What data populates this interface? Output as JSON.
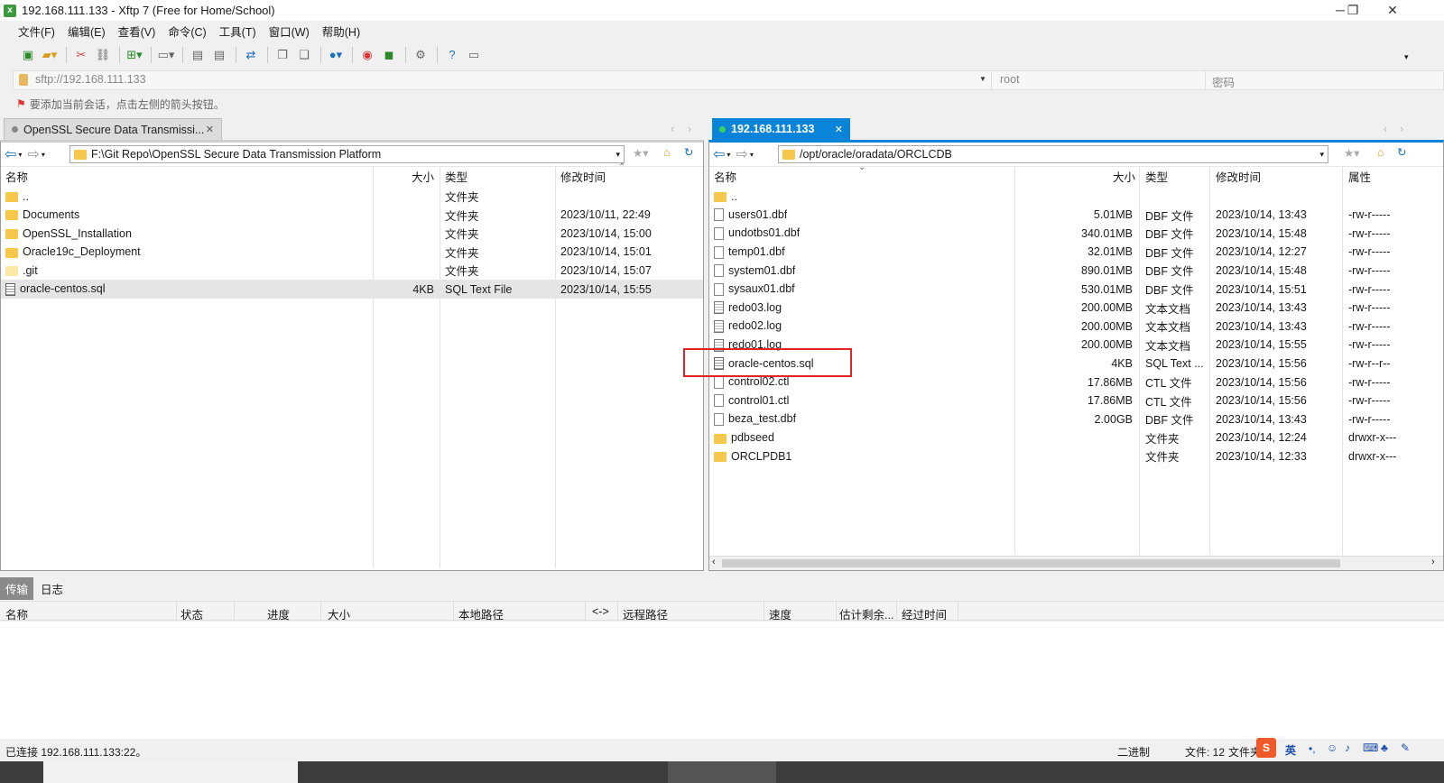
{
  "window": {
    "title": "192.168.111.133 - Xftp 7 (Free for Home/School)",
    "minimize": "─",
    "maximize": "❐",
    "close": "✕"
  },
  "menu": [
    "文件(F)",
    "编辑(E)",
    "查看(V)",
    "命令(C)",
    "工具(T)",
    "窗口(W)",
    "帮助(H)"
  ],
  "address": {
    "url": "sftp://192.168.111.133",
    "user": "root",
    "password_placeholder": "密码"
  },
  "hint": "要添加当前会话，点击左侧的箭头按钮。",
  "left": {
    "tab": "OpenSSL Secure Data Transmissi...",
    "path": "F:\\Git Repo\\OpenSSL Secure Data Transmission Platform",
    "headers": {
      "name": "名称",
      "size": "大小",
      "type": "类型",
      "modified": "修改时间"
    },
    "rows": [
      {
        "icon": "folder-up",
        "name": "..",
        "size": "",
        "type": "文件夹",
        "modified": ""
      },
      {
        "icon": "folder",
        "name": "Documents",
        "size": "",
        "type": "文件夹",
        "modified": "2023/10/11, 22:49"
      },
      {
        "icon": "folder",
        "name": "OpenSSL_Installation",
        "size": "",
        "type": "文件夹",
        "modified": "2023/10/14, 15:00"
      },
      {
        "icon": "folder",
        "name": "Oracle19c_Deployment",
        "size": "",
        "type": "文件夹",
        "modified": "2023/10/14, 15:01"
      },
      {
        "icon": "folder-hidden",
        "name": ".git",
        "size": "",
        "type": "文件夹",
        "modified": "2023/10/14, 15:07"
      },
      {
        "icon": "sql",
        "name": "oracle-centos.sql",
        "size": "4KB",
        "type": "SQL Text File",
        "modified": "2023/10/14, 15:55",
        "selected": true
      }
    ]
  },
  "right": {
    "tab": "192.168.111.133",
    "path": "/opt/oracle/oradata/ORCLCDB",
    "headers": {
      "name": "名称",
      "size": "大小",
      "type": "类型",
      "modified": "修改时间",
      "attr": "属性"
    },
    "rows": [
      {
        "icon": "folder-up",
        "name": "..",
        "size": "",
        "type": "",
        "modified": "",
        "attr": ""
      },
      {
        "icon": "file",
        "name": "users01.dbf",
        "size": "5.01MB",
        "type": "DBF 文件",
        "modified": "2023/10/14, 13:43",
        "attr": "-rw-r-----"
      },
      {
        "icon": "file",
        "name": "undotbs01.dbf",
        "size": "340.01MB",
        "type": "DBF 文件",
        "modified": "2023/10/14, 15:48",
        "attr": "-rw-r-----"
      },
      {
        "icon": "file",
        "name": "temp01.dbf",
        "size": "32.01MB",
        "type": "DBF 文件",
        "modified": "2023/10/14, 12:27",
        "attr": "-rw-r-----"
      },
      {
        "icon": "file",
        "name": "system01.dbf",
        "size": "890.01MB",
        "type": "DBF 文件",
        "modified": "2023/10/14, 15:48",
        "attr": "-rw-r-----"
      },
      {
        "icon": "file",
        "name": "sysaux01.dbf",
        "size": "530.01MB",
        "type": "DBF 文件",
        "modified": "2023/10/14, 15:51",
        "attr": "-rw-r-----"
      },
      {
        "icon": "log",
        "name": "redo03.log",
        "size": "200.00MB",
        "type": "文本文档",
        "modified": "2023/10/14, 13:43",
        "attr": "-rw-r-----"
      },
      {
        "icon": "log",
        "name": "redo02.log",
        "size": "200.00MB",
        "type": "文本文档",
        "modified": "2023/10/14, 13:43",
        "attr": "-rw-r-----"
      },
      {
        "icon": "log",
        "name": "redo01.log",
        "size": "200.00MB",
        "type": "文本文档",
        "modified": "2023/10/14, 15:55",
        "attr": "-rw-r-----"
      },
      {
        "icon": "sql",
        "name": "oracle-centos.sql",
        "size": "4KB",
        "type": "SQL Text ...",
        "modified": "2023/10/14, 15:56",
        "attr": "-rw-r--r--"
      },
      {
        "icon": "file",
        "name": "control02.ctl",
        "size": "17.86MB",
        "type": "CTL 文件",
        "modified": "2023/10/14, 15:56",
        "attr": "-rw-r-----"
      },
      {
        "icon": "file",
        "name": "control01.ctl",
        "size": "17.86MB",
        "type": "CTL 文件",
        "modified": "2023/10/14, 15:56",
        "attr": "-rw-r-----"
      },
      {
        "icon": "file",
        "name": "beza_test.dbf",
        "size": "2.00GB",
        "type": "DBF 文件",
        "modified": "2023/10/14, 13:43",
        "attr": "-rw-r-----"
      },
      {
        "icon": "folder",
        "name": "pdbseed",
        "size": "",
        "type": "文件夹",
        "modified": "2023/10/14, 12:24",
        "attr": "drwxr-x---"
      },
      {
        "icon": "folder",
        "name": "ORCLPDB1",
        "size": "",
        "type": "文件夹",
        "modified": "2023/10/14, 12:33",
        "attr": "drwxr-x---"
      }
    ]
  },
  "transfer": {
    "tabs": [
      "传输",
      "日志"
    ],
    "columns": [
      "名称",
      "状态",
      "进度",
      "大小",
      "本地路径",
      "<->",
      "远程路径",
      "速度",
      "估计剩余...",
      "经过时间"
    ]
  },
  "status": {
    "left": "已连接 192.168.111.133:22。",
    "mode": "二进制",
    "files": "文件: 12",
    "files_label": "文件夹",
    "ime": "英"
  }
}
